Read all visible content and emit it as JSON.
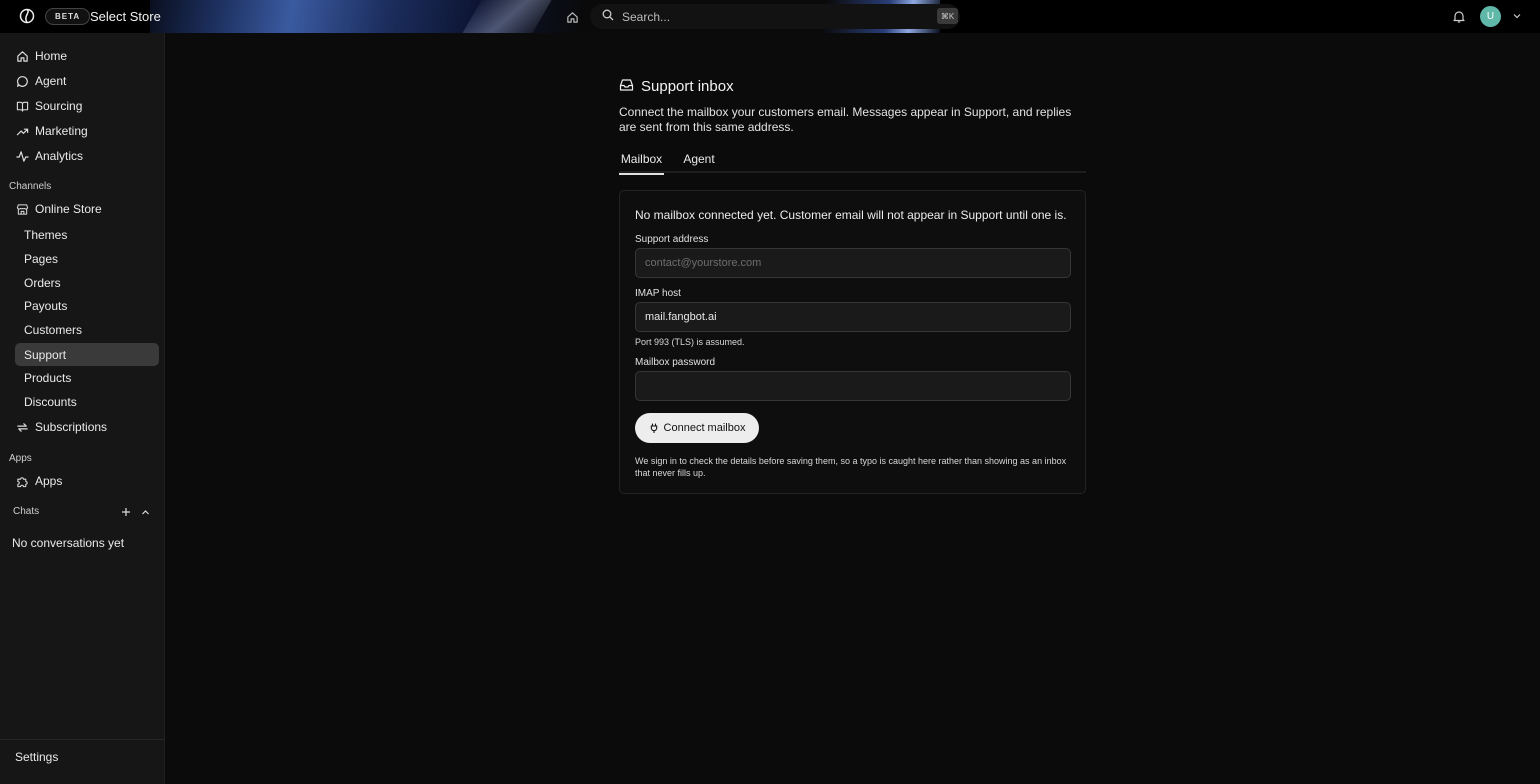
{
  "topbar": {
    "beta_label": "BETA",
    "store_name": "Select Store",
    "search_placeholder": "Search...",
    "search_shortcut": "⌘K",
    "avatar_initial": "U"
  },
  "sidebar": {
    "main_items": [
      {
        "label": "Home",
        "icon": "home-icon"
      },
      {
        "label": "Agent",
        "icon": "chat-bubble-icon"
      },
      {
        "label": "Sourcing",
        "icon": "book-icon"
      },
      {
        "label": "Marketing",
        "icon": "trend-up-icon"
      },
      {
        "label": "Analytics",
        "icon": "pulse-icon"
      }
    ],
    "channels_label": "Channels",
    "online_store_label": "Online Store",
    "sub_items": [
      {
        "label": "Themes"
      },
      {
        "label": "Pages"
      },
      {
        "label": "Orders"
      },
      {
        "label": "Payouts"
      },
      {
        "label": "Customers"
      },
      {
        "label": "Support",
        "active": true
      },
      {
        "label": "Products"
      },
      {
        "label": "Discounts"
      }
    ],
    "subscriptions_label": "Subscriptions",
    "apps_section_label": "Apps",
    "apps_label": "Apps",
    "chats_label": "Chats",
    "no_conversations": "No conversations yet",
    "settings_label": "Settings"
  },
  "page": {
    "title": "Support inbox",
    "description": "Connect the mailbox your customers email. Messages appear in Support, and replies are sent from this same address.",
    "tabs": [
      {
        "label": "Mailbox",
        "active": true
      },
      {
        "label": "Agent",
        "active": false
      }
    ]
  },
  "form": {
    "notice": "No mailbox connected yet. Customer email will not appear in Support until one is.",
    "support_address_label": "Support address",
    "support_address_placeholder": "contact@yourstore.com",
    "support_address_value": "",
    "imap_host_label": "IMAP host",
    "imap_host_value": "mail.fangbot.ai",
    "port_hint": "Port 993 (TLS) is assumed.",
    "password_label": "Mailbox password",
    "password_value": "",
    "connect_button": "Connect mailbox",
    "footnote": "We sign in to check the details before saving them, so a typo is caught here rather than showing as an inbox that never fills up."
  },
  "colors": {
    "background": "#0b0b0b",
    "sidebar": "#161616",
    "active_item": "#3a3a3a",
    "avatar": "#5fb8a8",
    "button": "#ededed"
  }
}
